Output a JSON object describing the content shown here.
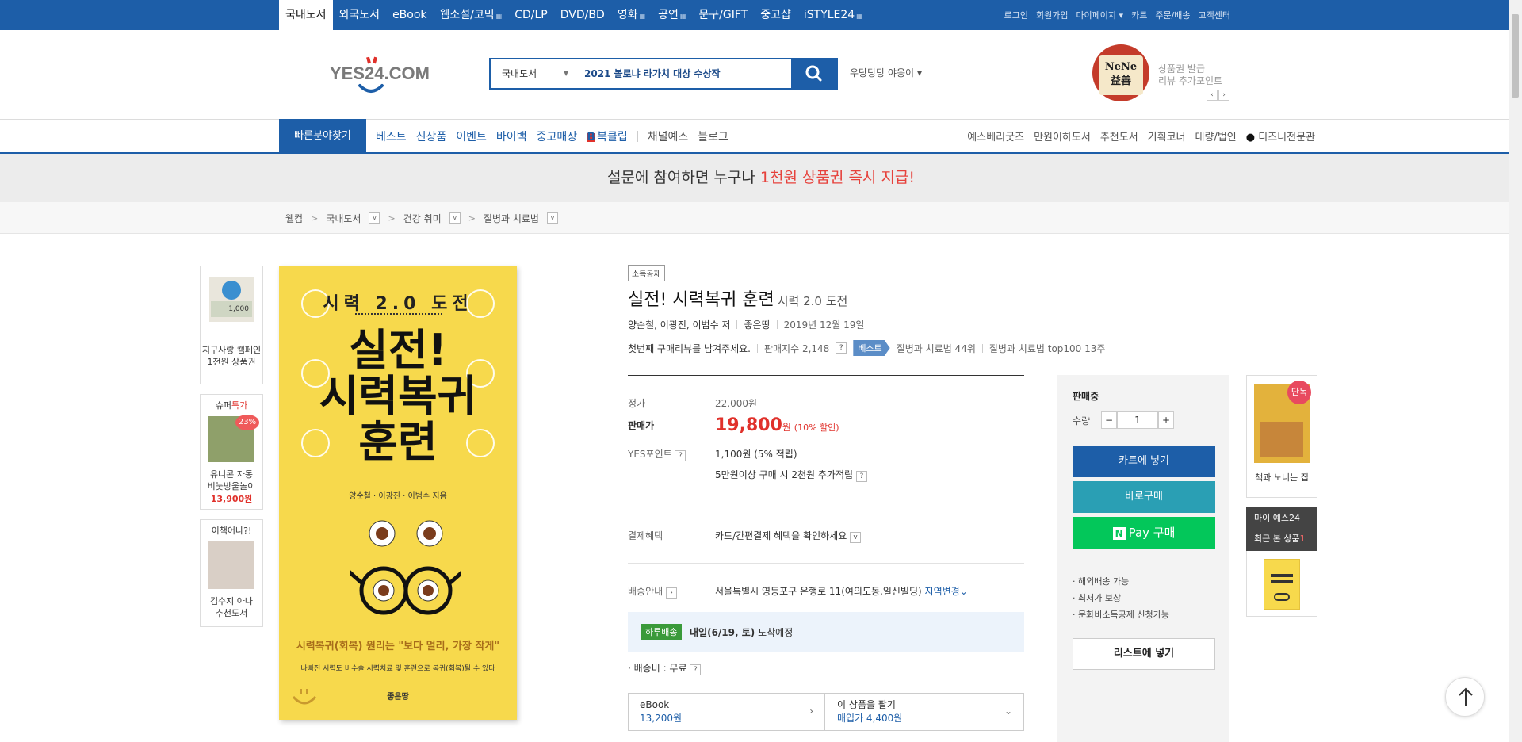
{
  "topbar": {
    "items": [
      {
        "label": "국내도서",
        "active": true
      },
      {
        "label": "외국도서"
      },
      {
        "label": "eBook"
      },
      {
        "label": "웹소설/코믹"
      },
      {
        "label": "CD/LP"
      },
      {
        "label": "DVD/BD"
      },
      {
        "label": "영화"
      },
      {
        "label": "공연"
      },
      {
        "label": "문구/GIFT"
      },
      {
        "label": "중고샵"
      },
      {
        "label": "iSTYLE24"
      }
    ],
    "right_links": [
      "로그인",
      "회원가입",
      "마이페이지",
      "카트",
      "주문/배송",
      "고객센터"
    ]
  },
  "header": {
    "logo_text": "YES24.COM",
    "search": {
      "category": "국내도서",
      "keyword": "2021 볼로냐 라가치 대상 수상작"
    },
    "sub_keyword": "우당탕탕 야옹이",
    "promo": {
      "logo_line1": "NeNe",
      "logo_line2": "益善",
      "line1": "상품권 발급",
      "line2": "리뷰 추가포인트"
    }
  },
  "gnb": {
    "quick_label": "빠른분야찾기",
    "left": [
      "베스트",
      "신상품",
      "이벤트",
      "바이백",
      "중고매장",
      "북클립",
      "채널예스",
      "블로그"
    ],
    "right": [
      "예스베리굿즈",
      "만원이하도서",
      "추천도서",
      "기획코너",
      "대량/법인",
      "디즈니전문관"
    ]
  },
  "banner": {
    "text_before": "설문에 참여하면 누구나 ",
    "highlight": "1천원 상품권 즉시 지급!"
  },
  "breadcrumb": [
    "웰컴",
    "국내도서",
    "건강 취미",
    "질병과 치료법"
  ],
  "side_promos": [
    {
      "caption1": "지구사랑 캠페인",
      "caption2": "1천원 상품권",
      "img_label": "1,000"
    },
    {
      "title_prefix": "슈퍼",
      "title_hl": "특가",
      "discount": "23%",
      "caption1": "유니콘 자동",
      "caption2": "비눗방울놀이",
      "price": "13,900원"
    },
    {
      "title": "이책어나?!",
      "caption1": "김수지 아나",
      "caption2": "추천도서"
    }
  ],
  "cover": {
    "sub_title": "시력 2.0 도전",
    "title_line1": "실전!",
    "title_line2": "시력복귀",
    "title_line3": "훈련",
    "authors": "양순철 · 이광진 · 이범수 지음",
    "tagline": "시력복귀(회복) 원리는 \"보다 멀리, 가장 작게\"",
    "tagline2": "나빠진 시력도 비수술 시력치료 및 훈련으로 복귀(회복)될 수 있다",
    "publisher": "좋은땅"
  },
  "product": {
    "badge": "소득공제",
    "title": "실전! 시력복귀 훈련",
    "subtitle": "시력 2.0 도전",
    "authors": "양순철, 이광진, 이범수 저",
    "publisher": "좋은땅",
    "date": "2019년 12월 19일",
    "review_prompt": "첫번째 구매리뷰를 남겨주세요.",
    "sales_index": "판매지수 2,148",
    "best_label": "베스트",
    "rank1": "질병과 치료법 44위",
    "rank2": "질병과 치료법 top100 13주",
    "price_label": "정가",
    "price": "22,000원",
    "sale_label": "판매가",
    "sale_price": "19,800",
    "sale_unit": "원",
    "sale_discount": "(10% 할인)",
    "point_label": "YES포인트",
    "point_value": "1,100원 (5% 적립)",
    "point_extra": "5만원이상 구매 시 2천원 추가적립",
    "payment_label": "결제혜택",
    "payment_value": "카드/간편결제 혜택을 확인하세요",
    "ship_label": "배송안내",
    "ship_address": "서울특별시 영등포구 은행로 11(여의도동,일신빌딩)",
    "region_change": "지역변경",
    "day_badge": "하루배송",
    "arrival_date": "내일(6/19, 토)",
    "arrival_text": "도착예정",
    "ship_fee": "· 배송비 : 무료",
    "ebook_label": "eBook",
    "ebook_price": "13,200원",
    "sell_label": "이 상품을 팔기",
    "sell_price": "매입가 4,400원"
  },
  "buy": {
    "status": "판매중",
    "qty_label": "수량",
    "qty": "1",
    "cart": "카트에 넣기",
    "buy_now": "바로구매",
    "npay": "Pay 구매",
    "list_items": [
      "해외배송 가능",
      "최저가 보상",
      "문화비소득공제 신청가능"
    ],
    "wishlist": "리스트에 넣기"
  },
  "rail": {
    "exclusive_badge": "단독",
    "exclusive_caption": "책과 노니는 집",
    "my_label": "마이 예스24",
    "recent_label": "최근 본 상품",
    "recent_count": "1"
  },
  "colors": {
    "brand": "#1d5ea8",
    "accent_red": "#e0312b",
    "teal": "#2a9fb4",
    "naver": "#03c75a"
  }
}
